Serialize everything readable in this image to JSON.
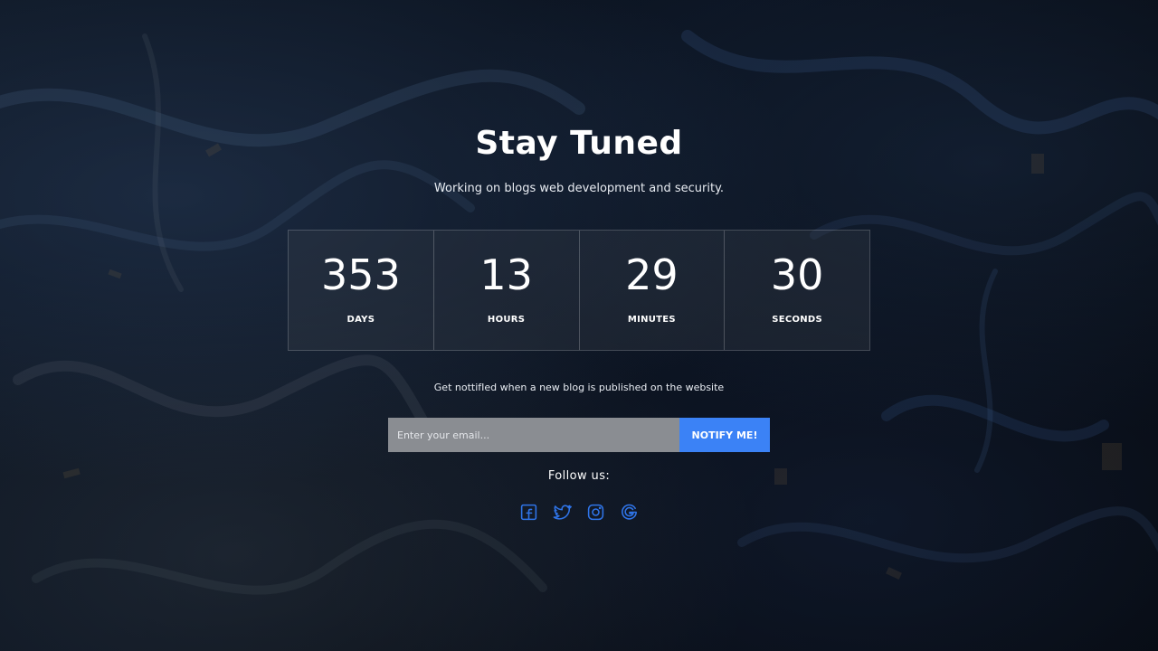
{
  "hero": {
    "title": "Stay Tuned",
    "subtitle": "Working on blogs web development and security."
  },
  "countdown": [
    {
      "value": "353",
      "label": "DAYS"
    },
    {
      "value": "13",
      "label": "HOURS"
    },
    {
      "value": "29",
      "label": "MINUTES"
    },
    {
      "value": "30",
      "label": "SECONDS"
    }
  ],
  "notify": {
    "text": "Get nottifIed when a new blog is published on the website",
    "email_placeholder": "Enter your email...",
    "button_label": "NOTIFY ME!"
  },
  "social": {
    "heading": "Follow us:",
    "icons": [
      "facebook-icon",
      "twitter-icon",
      "instagram-icon",
      "google-icon"
    ]
  },
  "colors": {
    "accent": "#3b82f6",
    "icon": "#2f74e8",
    "background": "#0b1320"
  }
}
